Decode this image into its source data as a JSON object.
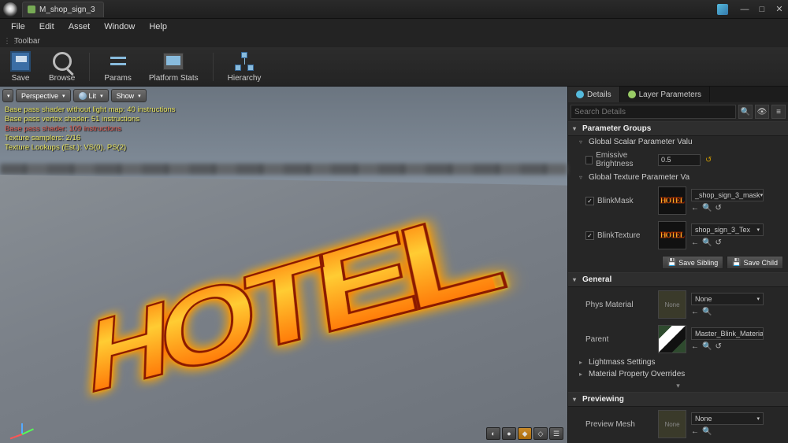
{
  "window": {
    "title": "M_shop_sign_3"
  },
  "menu": {
    "file": "File",
    "edit": "Edit",
    "asset": "Asset",
    "window": "Window",
    "help": "Help"
  },
  "toolbar_label": "Toolbar",
  "toolbar": {
    "save": "Save",
    "browse": "Browse",
    "params": "Params",
    "platform_stats": "Platform Stats",
    "hierarchy": "Hierarchy"
  },
  "viewport": {
    "dropdown": "▾",
    "perspective": "Perspective",
    "lit": "Lit",
    "show": "Show",
    "stats_line1": "Base pass shader without light map: 40 instructions",
    "stats_line2": "Base pass vertex shader: 51 instructions",
    "stats_line3": "Base pass shader: 109 instructions",
    "stats_line4": "Texture samplers: 2/16",
    "stats_line5": "Texture Lookups (Est.): VS(0), PS(2)",
    "neon_text": "HOTEL"
  },
  "details": {
    "tab_details": "Details",
    "tab_layer": "Layer Parameters",
    "search_placeholder": "Search Details",
    "cat_param_groups": "Parameter Groups",
    "sub_scalar": "Global Scalar Parameter Valu",
    "emissive_label": "Emissive Brightness",
    "emissive_value": "0.5",
    "sub_texture": "Global Texture Parameter Va",
    "blinkmask_label": "BlinkMask",
    "blinkmask_asset": "_shop_sign_3_mask",
    "blinktex_label": "BlinkTexture",
    "blinktex_asset": "shop_sign_3_Tex",
    "save_sibling": "Save Sibling",
    "save_child": "Save Child",
    "cat_general": "General",
    "phys_label": "Phys Material",
    "none": "None",
    "parent_label": "Parent",
    "parent_asset": "Master_Blink_Material",
    "sub_lightmass": "Lightmass Settings",
    "sub_overrides": "Material Property Overrides",
    "cat_preview": "Previewing",
    "preview_mesh": "Preview Mesh",
    "thumb_hotel": "HOTEL"
  }
}
